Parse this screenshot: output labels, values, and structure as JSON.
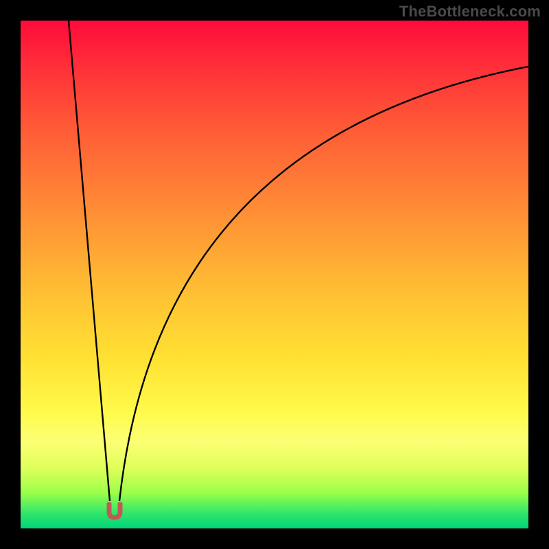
{
  "watermark": "TheBottleneck.com",
  "colors": {
    "frame": "#000000",
    "curve": "#000000",
    "valley_marker": "#c15a54",
    "gradient_top": "#ff0b3a",
    "gradient_bottom": "#00d37a"
  },
  "chart_data": {
    "type": "line",
    "title": "",
    "xlabel": "",
    "ylabel": "",
    "xlim": [
      0,
      100
    ],
    "ylim": [
      0,
      100
    ],
    "annotations": [
      {
        "name": "valley-minimum-marker",
        "x": 18.5,
        "y": 2,
        "color": "#c15a54",
        "shape": "u"
      }
    ],
    "series": [
      {
        "name": "left-branch",
        "x": [
          9.5,
          10,
          11,
          12,
          13,
          14,
          15,
          16,
          17,
          17.6
        ],
        "y": [
          100,
          92,
          80,
          68,
          56,
          44,
          33,
          22,
          12,
          4
        ]
      },
      {
        "name": "right-branch",
        "x": [
          19.4,
          20,
          21,
          22,
          24,
          26,
          29,
          33,
          38,
          44,
          51,
          59,
          68,
          78,
          89,
          100
        ],
        "y": [
          4,
          10,
          18,
          24,
          34,
          42,
          50,
          58,
          65,
          71,
          76,
          80,
          84,
          87,
          89.5,
          91
        ]
      }
    ]
  }
}
